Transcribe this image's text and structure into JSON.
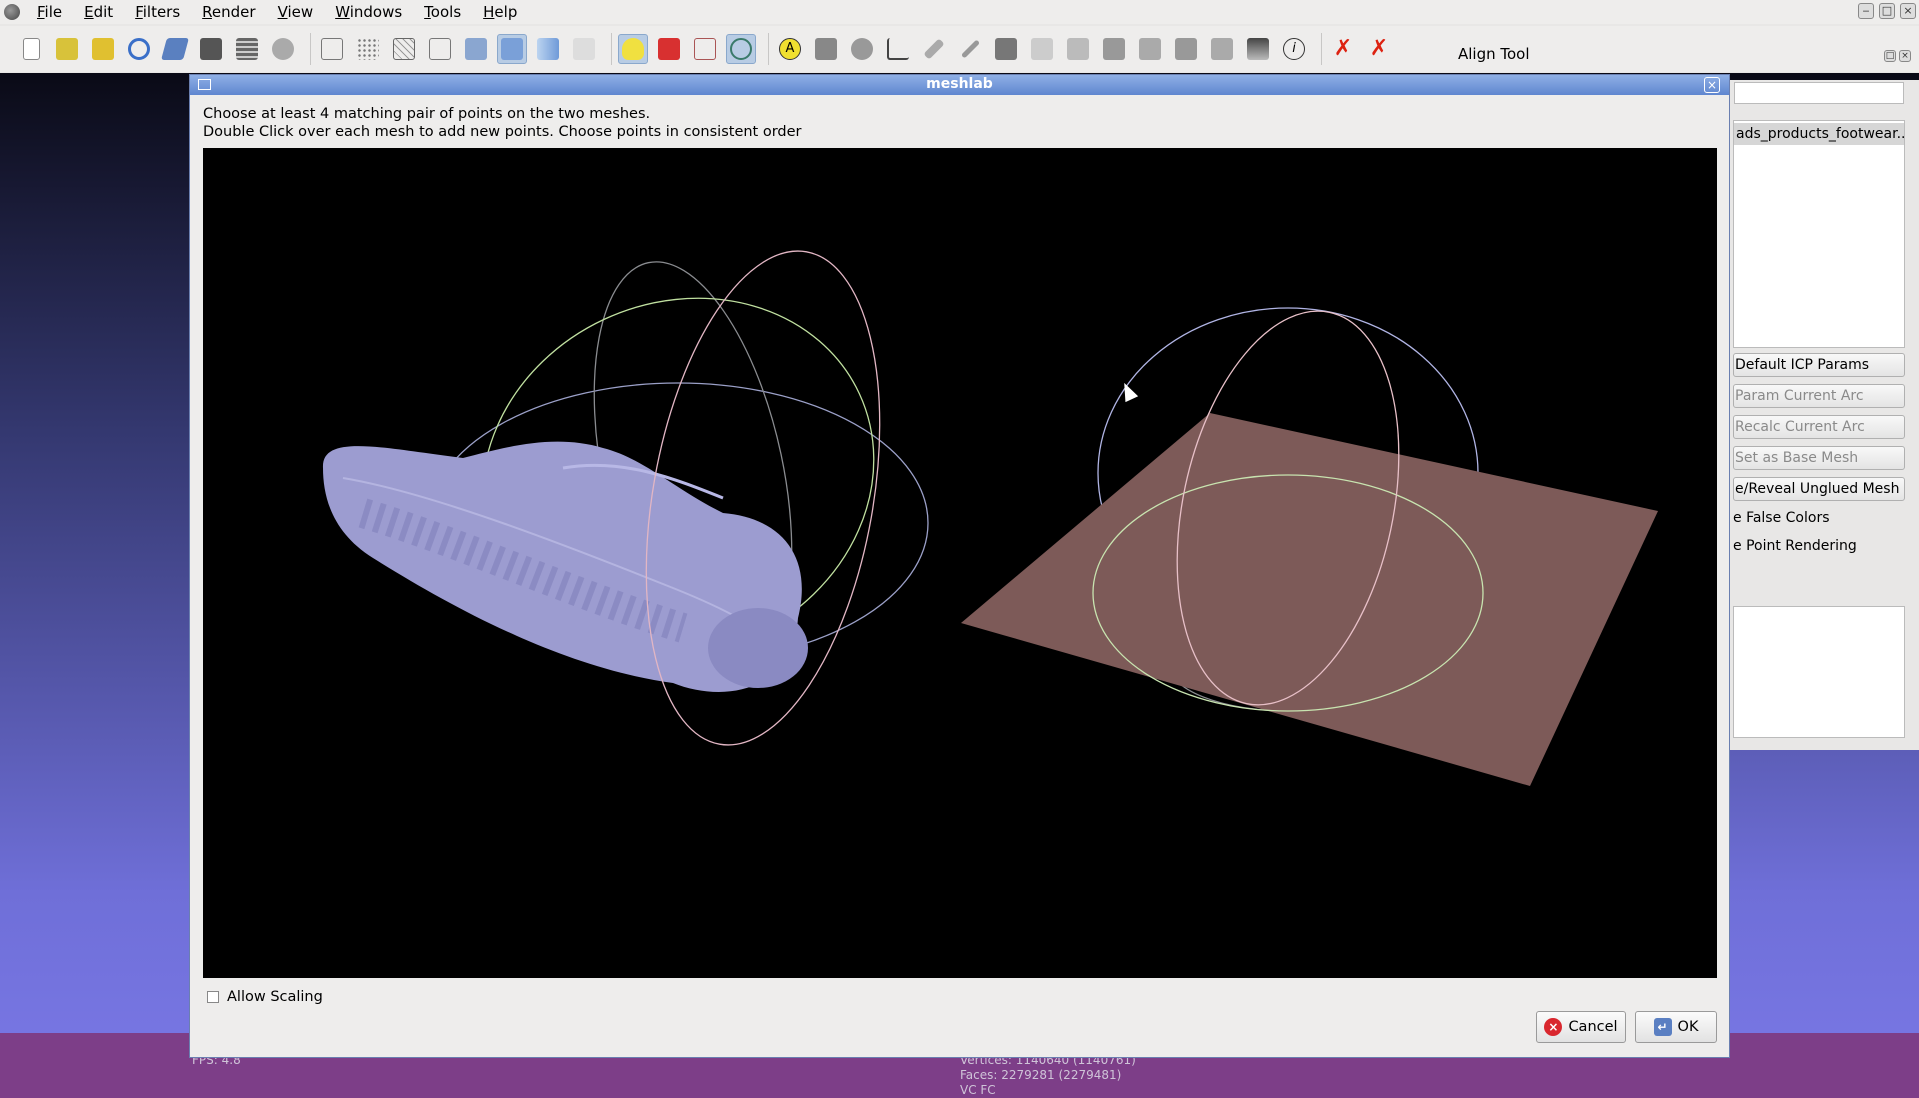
{
  "menubar": {
    "items": [
      "File",
      "Edit",
      "Filters",
      "Render",
      "View",
      "Windows",
      "Tools",
      "Help"
    ]
  },
  "toolbar": {
    "icons": [
      "new-icon",
      "open-project-icon",
      "open-icon",
      "reload-icon",
      "save-icon",
      "snapshot-icon",
      "layers-icon",
      "globe-icon",
      "bbox-icon",
      "points-icon",
      "wireframe-icon",
      "hidden-lines-icon",
      "flat-lines-icon",
      "flat-icon",
      "smooth-icon",
      "texture-icon",
      "light-icon",
      "backface-icon",
      "double-side-icon",
      "align-icon",
      "annotation-icon",
      "info-icon"
    ]
  },
  "dock": {
    "title": "Align Tool",
    "list_item": "ads_products_footwear...",
    "buttons": [
      {
        "label": "Default ICP Params",
        "disabled": false
      },
      {
        "label": "Param Current Arc",
        "disabled": true
      },
      {
        "label": "Recalc Current Arc",
        "disabled": true
      },
      {
        "label": "Set as Base Mesh",
        "disabled": true
      },
      {
        "label": "e/Reveal Unglued Mesh",
        "disabled": false
      }
    ],
    "checks": [
      "e False Colors",
      "e Point Rendering"
    ]
  },
  "status": {
    "fps": "FPS:    4.8",
    "vertices": "Vertices: 1140640 (1140761)",
    "faces": "Faces: 2279281 (2279481)",
    "vc": "VC FC"
  },
  "dialog": {
    "title": "meshlab",
    "instruction_1": "Choose at least 4 matching pair of points on the two meshes.",
    "instruction_2": "Double Click over each mesh to add new points. Choose points in consistent order",
    "allow_scaling": "Allow Scaling",
    "cancel": "Cancel",
    "ok": "OK"
  },
  "colors": {
    "shoe": "#9c9cd0",
    "plane": "#7d5a58",
    "statusbar": "#7d3e88",
    "titlebar": "#6f93d8"
  }
}
